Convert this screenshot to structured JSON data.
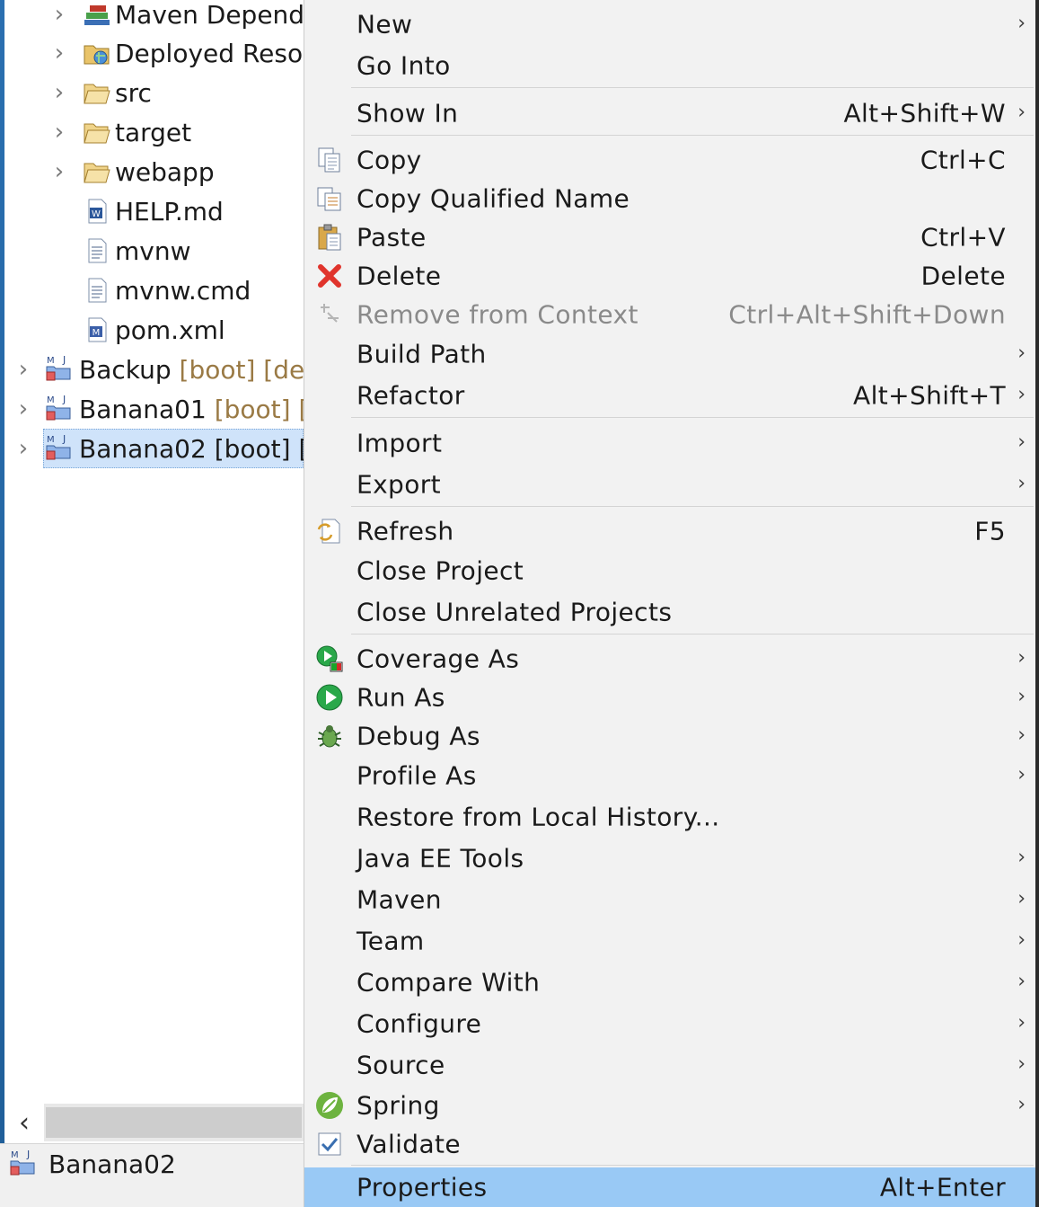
{
  "explorer": {
    "tree": [
      {
        "label": "Maven Depend",
        "deco": "",
        "icon": "library-books-icon",
        "chevron": true
      },
      {
        "label": "Deployed Reso",
        "deco": "",
        "icon": "deployed-resources-icon",
        "chevron": true
      },
      {
        "label": "src",
        "deco": "",
        "icon": "folder-open-icon",
        "chevron": true
      },
      {
        "label": "target",
        "deco": "",
        "icon": "folder-open-icon",
        "chevron": true
      },
      {
        "label": "webapp",
        "deco": "",
        "icon": "folder-open-icon",
        "chevron": true
      },
      {
        "label": "HELP.md",
        "deco": "",
        "icon": "markdown-file-icon",
        "chevron": false
      },
      {
        "label": "mvnw",
        "deco": "",
        "icon": "text-file-icon",
        "chevron": false
      },
      {
        "label": "mvnw.cmd",
        "deco": "",
        "icon": "text-file-icon",
        "chevron": false
      },
      {
        "label": "pom.xml",
        "deco": "",
        "icon": "maven-pom-icon",
        "chevron": false
      },
      {
        "label": "Backup",
        "deco": "[boot] [dev",
        "icon": "maven-project-icon",
        "chevron": true
      },
      {
        "label": "Banana01",
        "deco": "[boot] [",
        "icon": "maven-project-icon",
        "chevron": true
      },
      {
        "label": "Banana02",
        "deco": "[boot] [",
        "icon": "maven-project-icon",
        "chevron": true,
        "selected": true
      }
    ],
    "scroll_left_glyph": "‹",
    "status_label": "Banana02"
  },
  "menu": {
    "items": [
      {
        "label": "New",
        "shortcut": "",
        "submenu": true,
        "icon": ""
      },
      {
        "label": "Go Into",
        "shortcut": "",
        "submenu": false,
        "icon": ""
      },
      {
        "label": "Show In",
        "shortcut": "Alt+Shift+W",
        "submenu": true,
        "icon": ""
      },
      {
        "label": "Copy",
        "shortcut": "Ctrl+C",
        "submenu": false,
        "icon": "copy-icon"
      },
      {
        "label": "Copy Qualified Name",
        "shortcut": "",
        "submenu": false,
        "icon": "copy-qualified-name-icon"
      },
      {
        "label": "Paste",
        "shortcut": "Ctrl+V",
        "submenu": false,
        "icon": "paste-icon"
      },
      {
        "label": "Delete",
        "shortcut": "Delete",
        "submenu": false,
        "icon": "delete-icon"
      },
      {
        "label": "Remove from Context",
        "shortcut": "Ctrl+Alt+Shift+Down",
        "submenu": false,
        "icon": "remove-context-icon",
        "disabled": true
      },
      {
        "label": "Build Path",
        "shortcut": "",
        "submenu": true,
        "icon": ""
      },
      {
        "label": "Refactor",
        "shortcut": "Alt+Shift+T",
        "submenu": true,
        "icon": ""
      },
      {
        "label": "Import",
        "shortcut": "",
        "submenu": true,
        "icon": ""
      },
      {
        "label": "Export",
        "shortcut": "",
        "submenu": true,
        "icon": ""
      },
      {
        "label": "Refresh",
        "shortcut": "F5",
        "submenu": false,
        "icon": "refresh-icon"
      },
      {
        "label": "Close Project",
        "shortcut": "",
        "submenu": false,
        "icon": ""
      },
      {
        "label": "Close Unrelated Projects",
        "shortcut": "",
        "submenu": false,
        "icon": ""
      },
      {
        "label": "Coverage As",
        "shortcut": "",
        "submenu": true,
        "icon": "coverage-icon"
      },
      {
        "label": "Run As",
        "shortcut": "",
        "submenu": true,
        "icon": "run-icon"
      },
      {
        "label": "Debug As",
        "shortcut": "",
        "submenu": true,
        "icon": "debug-bug-icon"
      },
      {
        "label": "Profile As",
        "shortcut": "",
        "submenu": true,
        "icon": ""
      },
      {
        "label": "Restore from Local History...",
        "shortcut": "",
        "submenu": false,
        "icon": ""
      },
      {
        "label": "Java EE Tools",
        "shortcut": "",
        "submenu": true,
        "icon": ""
      },
      {
        "label": "Maven",
        "shortcut": "",
        "submenu": true,
        "icon": ""
      },
      {
        "label": "Team",
        "shortcut": "",
        "submenu": true,
        "icon": ""
      },
      {
        "label": "Compare With",
        "shortcut": "",
        "submenu": true,
        "icon": ""
      },
      {
        "label": "Configure",
        "shortcut": "",
        "submenu": true,
        "icon": ""
      },
      {
        "label": "Source",
        "shortcut": "",
        "submenu": true,
        "icon": ""
      },
      {
        "label": "Spring",
        "shortcut": "",
        "submenu": true,
        "icon": "spring-leaf-icon"
      },
      {
        "label": "Validate",
        "shortcut": "",
        "submenu": false,
        "icon": "validate-check-icon"
      },
      {
        "label": "Properties",
        "shortcut": "Alt+Enter",
        "submenu": false,
        "icon": "",
        "highlighted": true
      }
    ]
  },
  "colors": {
    "selection": "#cfe3fa",
    "menu_highlight": "#99c9f5",
    "menu_background": "#f2f2f2",
    "decoration_text": "#9a7a45"
  }
}
